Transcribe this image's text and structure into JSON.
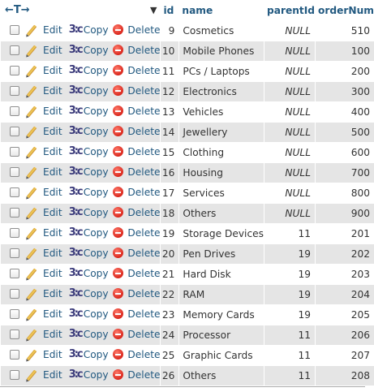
{
  "header": {
    "nav_arrows": "←T→",
    "sort_indicator": "▼",
    "columns": [
      "id",
      "name",
      "parentId",
      "orderNum"
    ]
  },
  "actions": {
    "edit": "Edit",
    "copy": "Copy",
    "delete": "Delete"
  },
  "rows": [
    {
      "id": "9",
      "name": "Cosmetics",
      "parentId": "NULL",
      "orderNum": "510"
    },
    {
      "id": "10",
      "name": "Mobile Phones",
      "parentId": "NULL",
      "orderNum": "100"
    },
    {
      "id": "11",
      "name": "PCs / Laptops",
      "parentId": "NULL",
      "orderNum": "200"
    },
    {
      "id": "12",
      "name": "Electronics",
      "parentId": "NULL",
      "orderNum": "300"
    },
    {
      "id": "13",
      "name": "Vehicles",
      "parentId": "NULL",
      "orderNum": "400"
    },
    {
      "id": "14",
      "name": "Jewellery",
      "parentId": "NULL",
      "orderNum": "500"
    },
    {
      "id": "15",
      "name": "Clothing",
      "parentId": "NULL",
      "orderNum": "600"
    },
    {
      "id": "16",
      "name": "Housing",
      "parentId": "NULL",
      "orderNum": "700"
    },
    {
      "id": "17",
      "name": "Services",
      "parentId": "NULL",
      "orderNum": "800"
    },
    {
      "id": "18",
      "name": "Others",
      "parentId": "NULL",
      "orderNum": "900"
    },
    {
      "id": "19",
      "name": "Storage Devices",
      "parentId": "11",
      "orderNum": "201"
    },
    {
      "id": "20",
      "name": "Pen Drives",
      "parentId": "19",
      "orderNum": "202"
    },
    {
      "id": "21",
      "name": "Hard Disk",
      "parentId": "19",
      "orderNum": "203"
    },
    {
      "id": "22",
      "name": "RAM",
      "parentId": "19",
      "orderNum": "204"
    },
    {
      "id": "23",
      "name": "Memory Cards",
      "parentId": "19",
      "orderNum": "205"
    },
    {
      "id": "24",
      "name": "Processor",
      "parentId": "11",
      "orderNum": "206"
    },
    {
      "id": "25",
      "name": "Graphic Cards",
      "parentId": "11",
      "orderNum": "207"
    },
    {
      "id": "26",
      "name": "Others",
      "parentId": "11",
      "orderNum": "208"
    }
  ]
}
